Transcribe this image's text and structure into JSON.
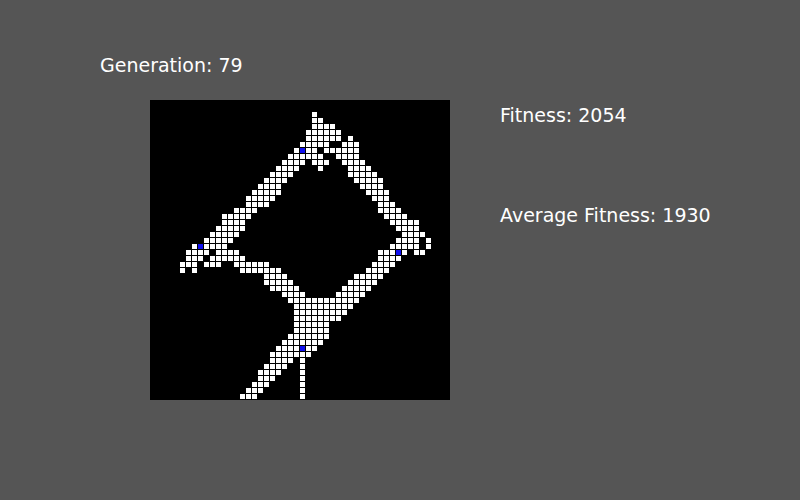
{
  "generation": "Generation: 79",
  "fitness": "Fitness: 2054",
  "average_fitness": "Average Fitness: 1930",
  "grid": {
    "size": 50,
    "rows": [
      [],
      [],
      [
        [
          27,
          27
        ]
      ],
      [
        [
          27,
          28
        ]
      ],
      [
        [
          27,
          30
        ]
      ],
      [
        [
          26,
          31
        ]
      ],
      [
        [
          26,
          31
        ],
        [
          33,
          33
        ]
      ],
      [
        [
          25,
          29
        ],
        [
          32,
          34
        ]
      ],
      [
        [
          24,
          27
        ],
        [
          29,
          34
        ]
      ],
      [
        [
          23,
          28
        ],
        [
          31,
          34
        ]
      ],
      [
        [
          22,
          25
        ],
        [
          27,
          29
        ],
        [
          32,
          35
        ]
      ],
      [
        [
          21,
          24
        ],
        [
          28,
          28
        ],
        [
          33,
          36
        ]
      ],
      [
        [
          20,
          23
        ],
        [
          33,
          37
        ]
      ],
      [
        [
          19,
          22
        ],
        [
          34,
          38
        ]
      ],
      [
        [
          18,
          21
        ],
        [
          35,
          38
        ]
      ],
      [
        [
          17,
          21
        ],
        [
          36,
          39
        ]
      ],
      [
        [
          16,
          20
        ],
        [
          37,
          39
        ]
      ],
      [
        [
          16,
          19
        ],
        [
          38,
          40
        ]
      ],
      [
        [
          14,
          17
        ],
        [
          38,
          41
        ]
      ],
      [
        [
          12,
          16
        ],
        [
          39,
          42
        ]
      ],
      [
        [
          12,
          15
        ],
        [
          40,
          44
        ]
      ],
      [
        [
          11,
          15
        ],
        [
          41,
          44
        ]
      ],
      [
        [
          10,
          14
        ],
        [
          42,
          45
        ]
      ],
      [
        [
          9,
          13
        ],
        [
          41,
          44
        ],
        [
          46,
          46
        ]
      ],
      [
        [
          7,
          12
        ],
        [
          40,
          44
        ],
        [
          46,
          46
        ]
      ],
      [
        [
          6,
          9
        ],
        [
          11,
          14
        ],
        [
          38,
          42
        ],
        [
          44,
          45
        ]
      ],
      [
        [
          6,
          8
        ],
        [
          10,
          15
        ],
        [
          38,
          41
        ]
      ],
      [
        [
          5,
          7
        ],
        [
          9,
          11
        ],
        [
          14,
          19
        ],
        [
          37,
          40
        ]
      ],
      [
        [
          5,
          5
        ],
        [
          7,
          7
        ],
        [
          15,
          21
        ],
        [
          36,
          39
        ]
      ],
      [
        [
          19,
          22
        ],
        [
          34,
          38
        ]
      ],
      [
        [
          19,
          23
        ],
        [
          33,
          37
        ]
      ],
      [
        [
          20,
          24
        ],
        [
          32,
          36
        ]
      ],
      [
        [
          22,
          25
        ],
        [
          31,
          35
        ]
      ],
      [
        [
          23,
          34
        ]
      ],
      [
        [
          24,
          33
        ]
      ],
      [
        [
          24,
          32
        ]
      ],
      [
        [
          24,
          31
        ]
      ],
      [
        [
          24,
          29
        ]
      ],
      [
        [
          24,
          29
        ]
      ],
      [
        [
          23,
          29
        ]
      ],
      [
        [
          22,
          28
        ]
      ],
      [
        [
          21,
          27
        ]
      ],
      [
        [
          20,
          26
        ]
      ],
      [
        [
          20,
          23
        ],
        [
          25,
          25
        ]
      ],
      [
        [
          19,
          22
        ],
        [
          25,
          25
        ]
      ],
      [
        [
          18,
          21
        ],
        [
          25,
          25
        ]
      ],
      [
        [
          18,
          20
        ],
        [
          25,
          25
        ]
      ],
      [
        [
          17,
          19
        ],
        [
          25,
          25
        ]
      ],
      [
        [
          16,
          18
        ],
        [
          25,
          25
        ]
      ],
      [
        [
          15,
          17
        ],
        [
          25,
          25
        ]
      ]
    ],
    "blue": [
      [
        8,
        25
      ],
      [
        24,
        8
      ],
      [
        25,
        41
      ],
      [
        41,
        25
      ]
    ]
  }
}
